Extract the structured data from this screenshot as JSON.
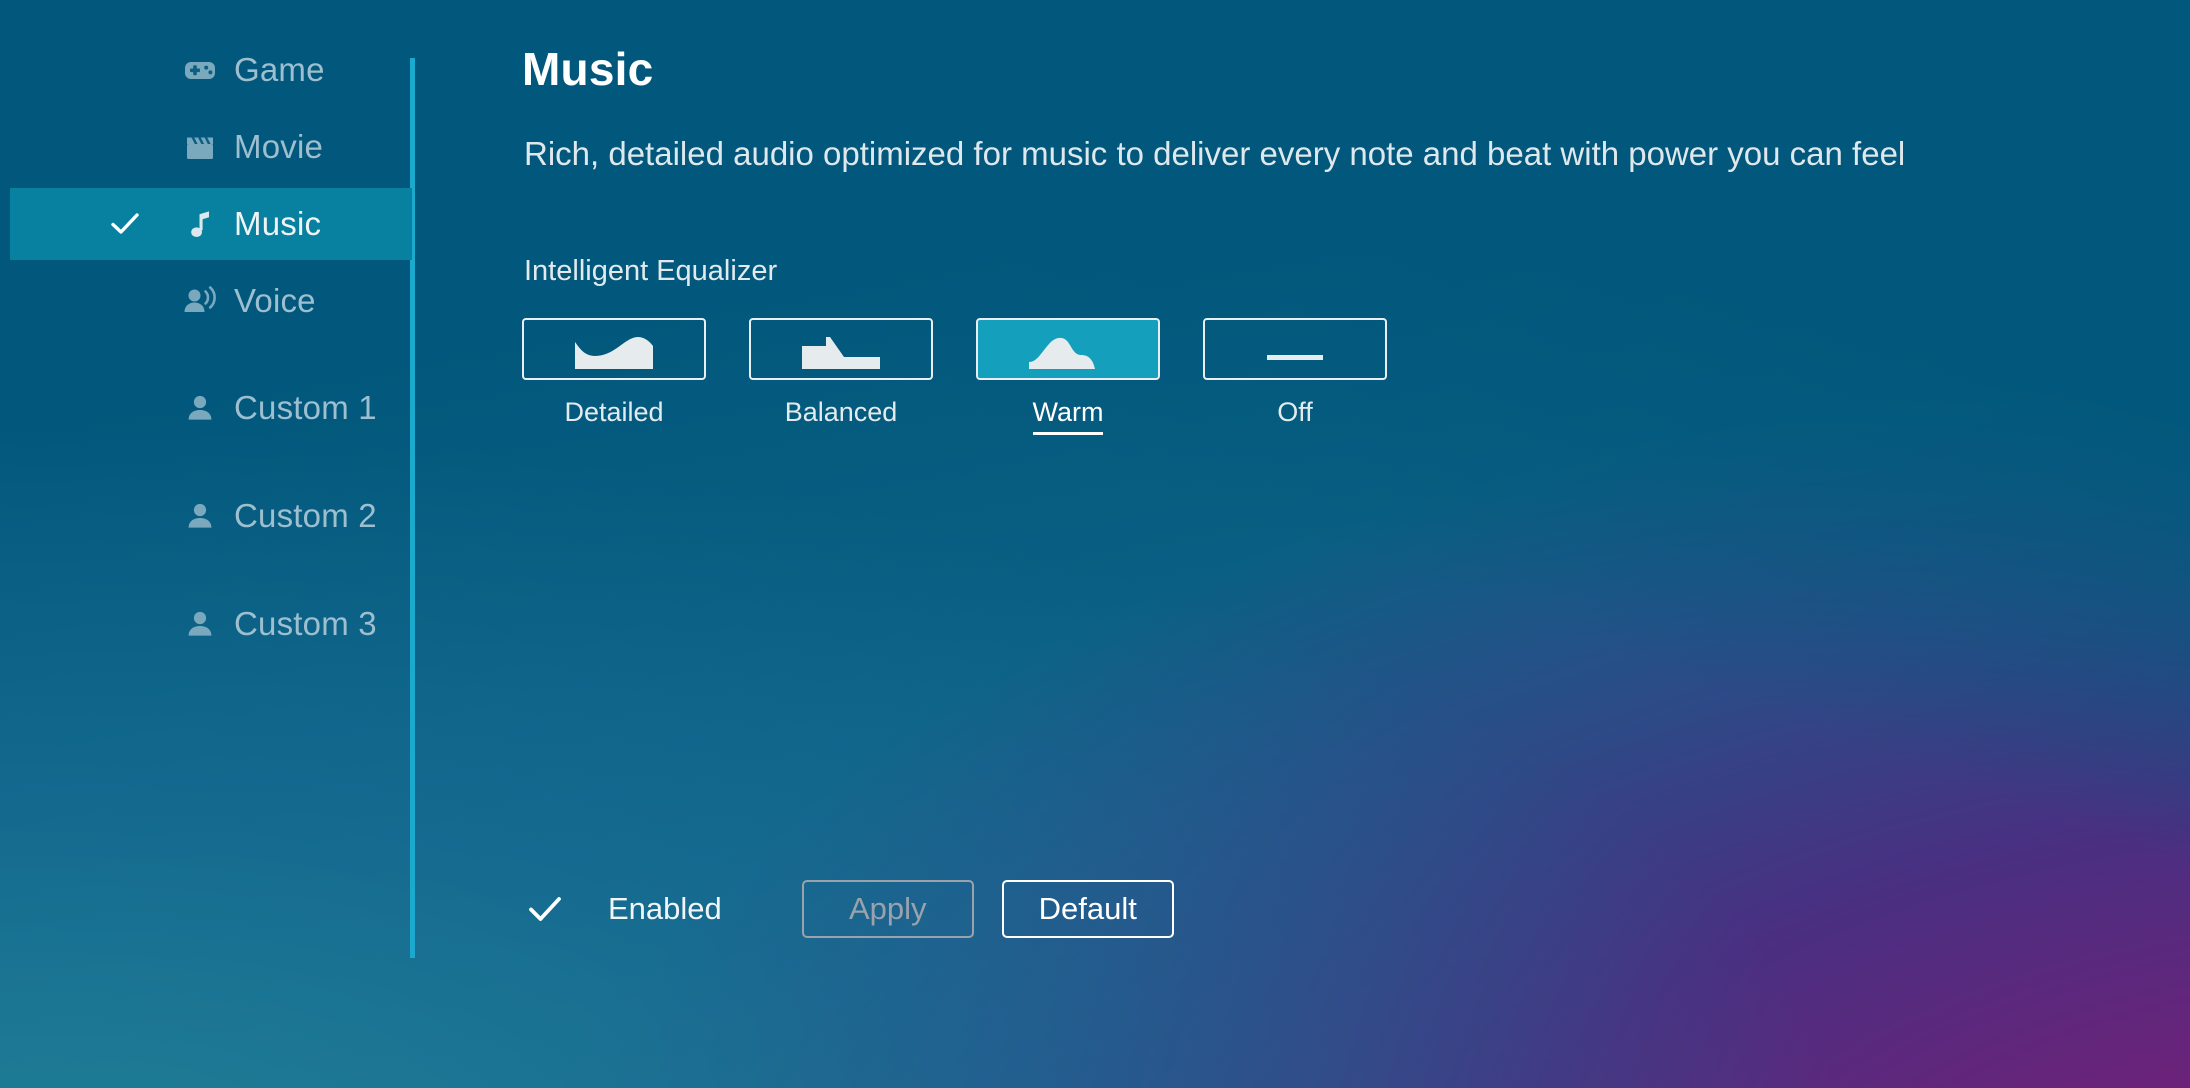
{
  "theme": {
    "accent_teal": "#14a0bd",
    "divider_cyan": "#1ba9cd",
    "selected_row": "#07819f",
    "bg_start": "#02587c",
    "bg_end_purple": "#6d2279",
    "text_primary": "#ffffff",
    "text_muted": "#9dbfcf",
    "disabled": "#9aa3ab"
  },
  "sidebar": {
    "items": [
      {
        "id": "game",
        "label": "Game",
        "icon": "gamepad-icon",
        "selected": false
      },
      {
        "id": "movie",
        "label": "Movie",
        "icon": "clapperboard-icon",
        "selected": false
      },
      {
        "id": "music",
        "label": "Music",
        "icon": "music-note-icon",
        "selected": true
      },
      {
        "id": "voice",
        "label": "Voice",
        "icon": "voice-person-icon",
        "selected": false
      },
      {
        "id": "custom1",
        "label": "Custom 1",
        "icon": "person-icon",
        "selected": false
      },
      {
        "id": "custom2",
        "label": "Custom 2",
        "icon": "person-icon",
        "selected": false
      },
      {
        "id": "custom3",
        "label": "Custom 3",
        "icon": "person-icon",
        "selected": false
      }
    ],
    "selected_check_icon": "check-icon"
  },
  "main": {
    "title": "Music",
    "description": "Rich, detailed audio optimized for music to deliver every note and beat with power you can feel",
    "eq": {
      "section_label": "Intelligent Equalizer",
      "selected": "Warm",
      "presets": [
        {
          "label": "Detailed",
          "icon": "eq-curve-detailed-icon",
          "selected": false
        },
        {
          "label": "Balanced",
          "icon": "eq-curve-balanced-icon",
          "selected": false
        },
        {
          "label": "Warm",
          "icon": "eq-curve-warm-icon",
          "selected": true
        },
        {
          "label": "Off",
          "icon": "eq-curve-flat-icon",
          "selected": false
        }
      ]
    }
  },
  "footer": {
    "enabled_check_icon": "check-icon",
    "enabled_label": "Enabled",
    "apply_label": "Apply",
    "apply_disabled": true,
    "default_label": "Default",
    "default_disabled": false
  }
}
